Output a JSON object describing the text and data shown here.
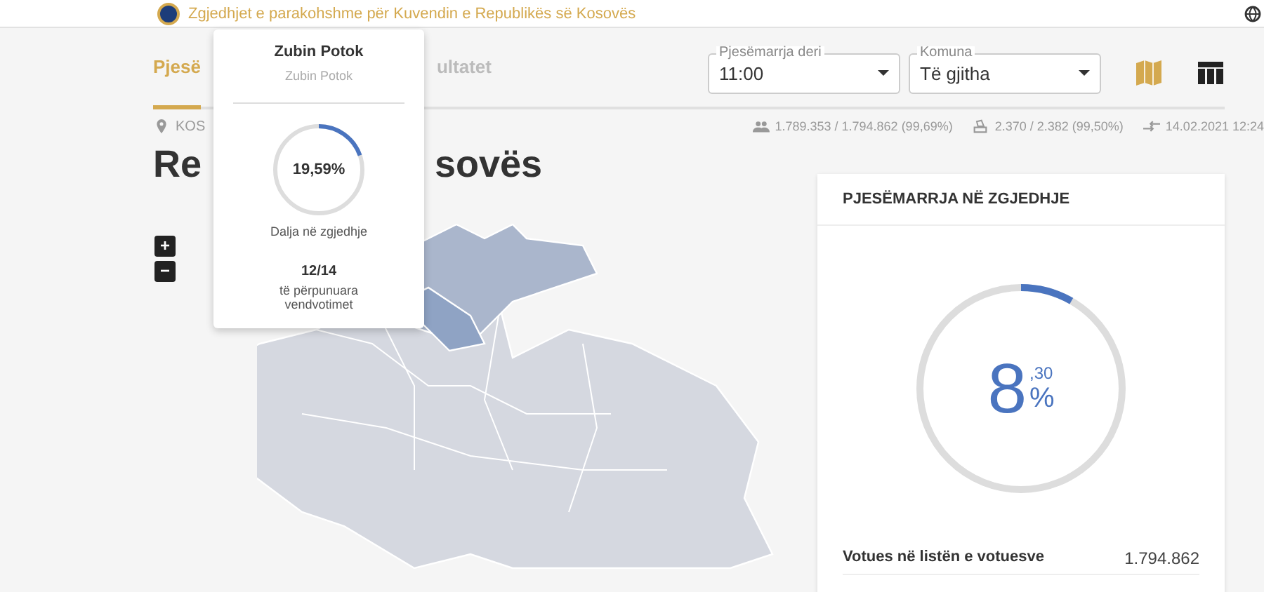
{
  "header": {
    "subtitle": "Zgjedhjet e parakohshme për Kuvendin e Republikës së Kosovës"
  },
  "tabs": [
    {
      "label": "Pjesë",
      "selected": true
    },
    {
      "label": "ultatet",
      "selected": false
    }
  ],
  "filters": [
    {
      "label": "Pjesëmarrja deri",
      "value": "11:00"
    },
    {
      "label": "Komuna",
      "value": "Të gjitha"
    }
  ],
  "view_toggles": [
    {
      "kind": "map",
      "selected": true
    },
    {
      "kind": "table",
      "selected": false
    }
  ],
  "breadcrumb": "KOS",
  "stats": [
    {
      "kind": "voters",
      "text": "1.789.353 / 1.794.862 (99,69%)"
    },
    {
      "kind": "stations",
      "text": "2.370 / 2.382 (99,50%)"
    },
    {
      "kind": "updated",
      "text": "14.02.2021 12:24"
    }
  ],
  "title_parts": [
    "Re",
    "sovës"
  ],
  "zoom_controls": [
    "+",
    "−"
  ],
  "tooltip": {
    "title": "Zubin Potok",
    "subtitle": "Zubin Potok",
    "level": 0.1959,
    "percent": "19,59%",
    "caption": "Dalja në zgjedhje",
    "count": "12/14",
    "count_label": "të përpunuara vendvotimet"
  },
  "card": {
    "title": "PJESËMARRJA NË ZGJEDHJE",
    "level": 0.083,
    "value": "8",
    "decimal": ",30",
    "unit": "%",
    "rows": [
      {
        "label": "Votues në listën e votuesve",
        "value": "1.794.862"
      }
    ]
  }
}
